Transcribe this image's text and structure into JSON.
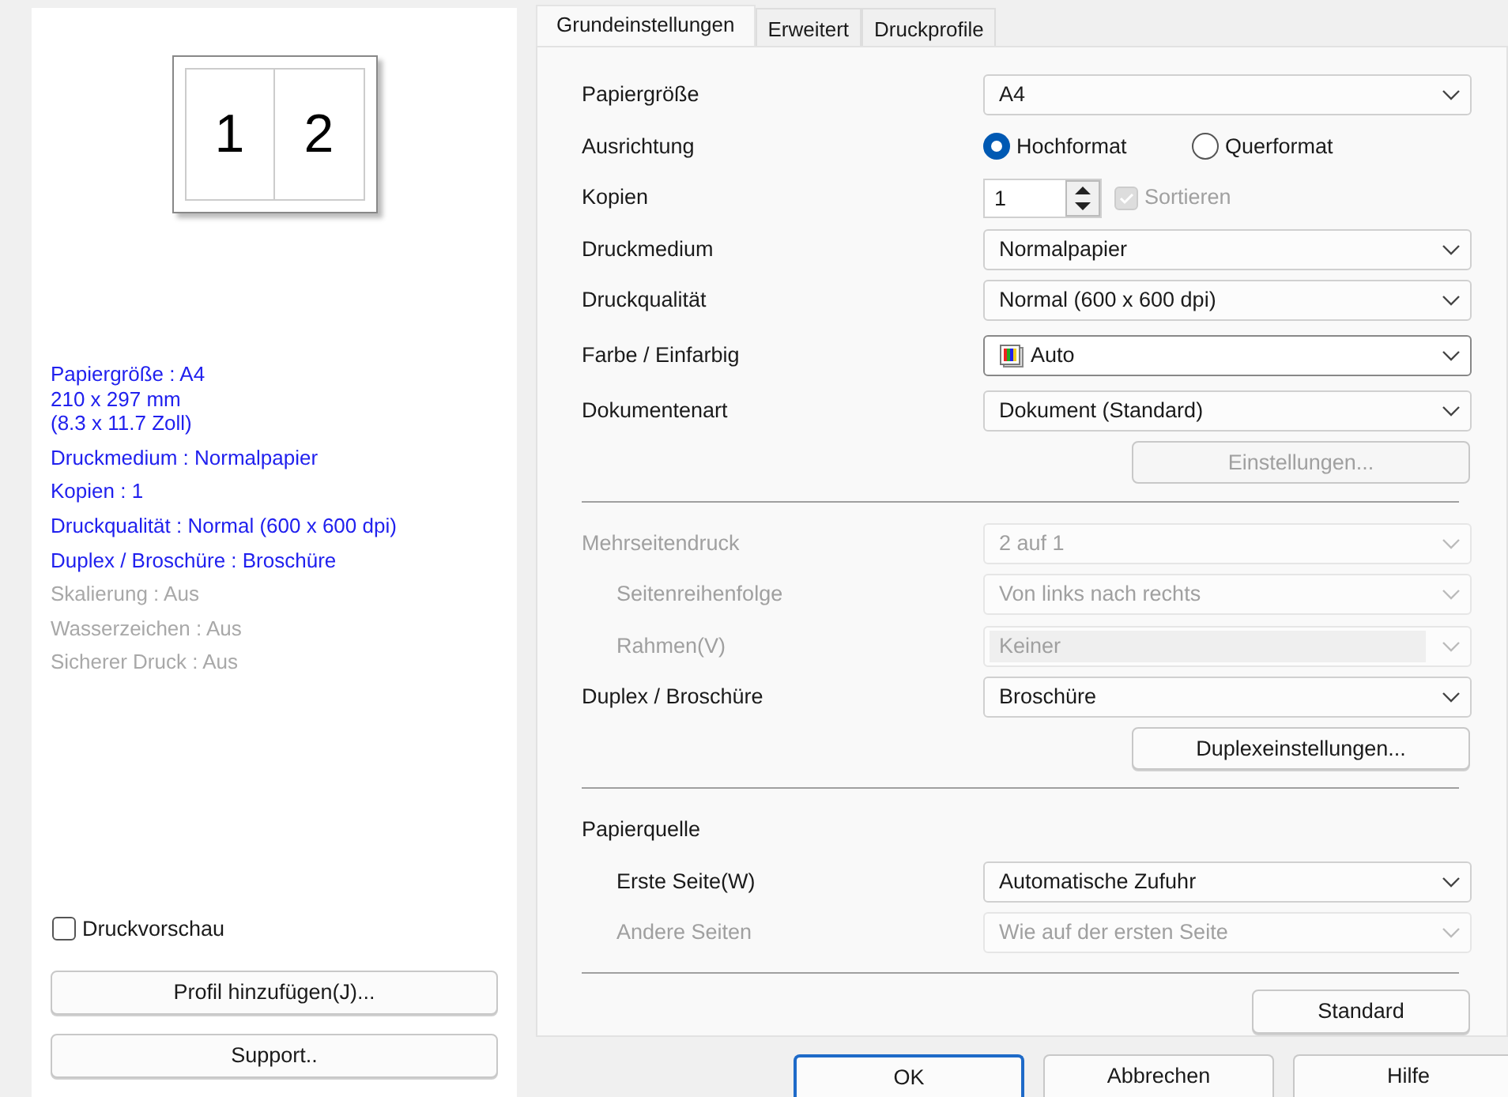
{
  "preview": {
    "pages": [
      "1",
      "2"
    ]
  },
  "summary": [
    {
      "lines": [
        "Papiergröße : A4",
        "210 x 297 mm",
        "(8.3 x 11.7 Zoll)"
      ],
      "active": true
    },
    {
      "lines": [
        "Druckmedium : Normalpapier"
      ],
      "active": true
    },
    {
      "lines": [
        "Kopien : 1"
      ],
      "active": true
    },
    {
      "lines": [
        "Druckqualität : Normal (600 x 600 dpi)"
      ],
      "active": true
    },
    {
      "lines": [
        "Duplex / Broschüre : Broschüre"
      ],
      "active": true
    },
    {
      "lines": [
        "Skalierung : Aus"
      ],
      "active": false
    },
    {
      "lines": [
        "Wasserzeichen : Aus"
      ],
      "active": false
    },
    {
      "lines": [
        "Sicherer Druck : Aus"
      ],
      "active": false
    }
  ],
  "print_preview": {
    "label": "Druckvorschau",
    "checked": false
  },
  "left_buttons": [
    "Profil hinzufügen(J)...",
    "Support.."
  ],
  "tabs": [
    {
      "label": "Grundeinstellungen",
      "selected": true
    },
    {
      "label": "Erweitert",
      "selected": false
    },
    {
      "label": "Druckprofile",
      "selected": false
    }
  ],
  "settings": [
    {
      "kind": "select",
      "label": "Papiergröße",
      "value": "A4",
      "disabled": false
    },
    {
      "kind": "radio",
      "label": "Ausrichtung",
      "options": [
        {
          "label": "Hochformat",
          "selected": true
        },
        {
          "label": "Querformat",
          "selected": false
        }
      ]
    },
    {
      "kind": "spinner",
      "label": "Kopien",
      "value": "1",
      "checkbox": {
        "label": "Sortieren",
        "checked": true,
        "disabled": true
      }
    },
    {
      "kind": "select",
      "label": "Druckmedium",
      "value": "Normalpapier",
      "disabled": false
    },
    {
      "kind": "select",
      "label": "Druckqualität",
      "value": "Normal (600 x 600 dpi)",
      "disabled": false
    },
    {
      "kind": "iconselect",
      "label": "Farbe / Einfarbig",
      "value": "Auto",
      "disabled": false
    },
    {
      "kind": "select",
      "label": "Dokumentenart",
      "value": "Dokument (Standard)",
      "disabled": false
    },
    {
      "kind": "button",
      "label": "Einstellungen...",
      "disabled": true
    },
    {
      "kind": "separator"
    },
    {
      "kind": "select",
      "label": "Mehrseitendruck",
      "value": "2 auf 1",
      "disabled": true,
      "children": [
        {
          "kind": "select",
          "label": "Seitenreihenfolge",
          "value": "Von links nach rechts",
          "disabled": true
        },
        {
          "kind": "combo",
          "label": "Rahmen(V)",
          "value": "Keiner",
          "disabled": true
        }
      ]
    },
    {
      "kind": "select",
      "label": "Duplex / Broschüre",
      "value": "Broschüre",
      "disabled": false
    },
    {
      "kind": "button",
      "label": "Duplexeinstellungen...",
      "disabled": false
    },
    {
      "kind": "separator"
    },
    {
      "kind": "heading",
      "label": "Papierquelle",
      "children": [
        {
          "kind": "select",
          "label": "Erste Seite(W)",
          "value": "Automatische Zufuhr",
          "disabled": false
        },
        {
          "kind": "select",
          "label": "Andere Seiten",
          "value": "Wie auf der ersten Seite",
          "disabled": true
        }
      ]
    },
    {
      "kind": "separator"
    }
  ],
  "standard_button": "Standard",
  "dialog_buttons": [
    {
      "label": "OK",
      "default": true
    },
    {
      "label": "Abbrechen",
      "default": false
    },
    {
      "label": "Hilfe",
      "default": false
    }
  ]
}
